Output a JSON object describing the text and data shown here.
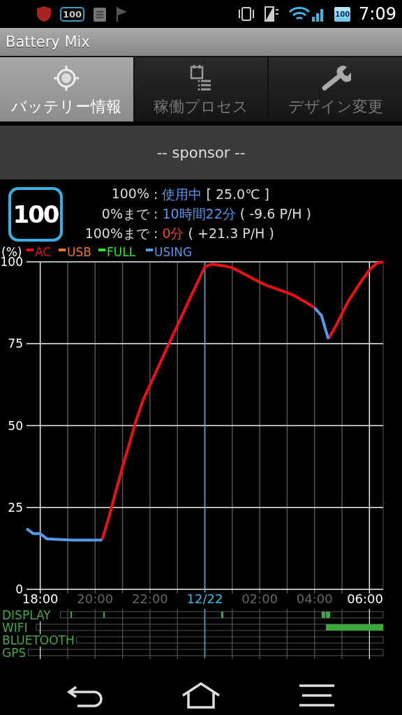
{
  "status_bar": {
    "notification_badge": "100",
    "battery": "100",
    "time": "7:09"
  },
  "title": "Battery Mix",
  "tabs": [
    {
      "label": "バッテリー情報",
      "selected": true
    },
    {
      "label": "稼働プロセス",
      "selected": false
    },
    {
      "label": "デザイン変更",
      "selected": false
    }
  ],
  "sponsor": "-- sponsor --",
  "battery_badge": "100",
  "info": [
    {
      "label": "100%",
      "separator": ":",
      "value": "使用中",
      "color": "#5599ee",
      "detail": "[ 25.0℃ ]"
    },
    {
      "label": "0%まで",
      "separator": ":",
      "value": "10時間22分",
      "color": "#5599ee",
      "detail": "( -9.6 P/H )"
    },
    {
      "label": "100%まで",
      "separator": ":",
      "value": "0分",
      "color": "#ee4422",
      "detail": "( +21.3 P/H )"
    }
  ],
  "chart_data": {
    "type": "line",
    "ylabel": "(%)",
    "ylim": [
      0,
      100
    ],
    "grid": true,
    "legend": true,
    "yticks": [
      0,
      25,
      50,
      75,
      100
    ],
    "categories": [
      null,
      null,
      "18:00",
      null,
      null,
      null,
      null,
      null,
      null,
      null,
      "20:00",
      null,
      null,
      null,
      null,
      null,
      null,
      null,
      "22:00",
      null,
      null,
      null,
      null,
      null,
      null,
      null,
      "12/22",
      null,
      null,
      null,
      null,
      null,
      null,
      null,
      "02:00",
      null,
      null,
      null,
      null,
      null,
      null,
      null,
      "04:00",
      null,
      null,
      null,
      null,
      null,
      null,
      null,
      "06:00",
      null,
      null
    ],
    "ref_lines": [
      {
        "axis": "x",
        "value": "12/22",
        "color": "#33bbee"
      }
    ],
    "series": [
      {
        "name": "AC",
        "color": "#ee1111",
        "values": [
          null,
          null,
          null,
          null,
          null,
          null,
          null,
          null,
          null,
          null,
          null,
          15,
          21.9,
          29.8,
          37.4,
          44.5,
          51.7,
          57.8,
          62.4,
          66.9,
          71.5,
          76.1,
          80.6,
          85.1,
          89.6,
          94.0,
          98.5,
          99.3,
          99.0,
          98.7,
          98.2,
          97.1,
          96.0,
          94.9,
          93.8,
          92.8,
          92.1,
          91.3,
          90.6,
          89.7,
          88.5,
          87.3,
          86.0,
          null,
          76.5,
          80.0,
          84.2,
          88.3,
          91.5,
          94.7,
          97.5,
          99.5,
          100
        ]
      },
      {
        "name": "USB",
        "color": "#ee7711",
        "values": [
          null,
          null,
          null,
          null,
          null,
          null,
          null,
          null,
          null,
          null,
          null,
          null,
          null,
          null,
          null,
          null,
          null,
          null,
          null,
          null,
          null,
          null,
          null,
          null,
          null,
          null,
          null,
          null,
          null,
          null,
          null,
          null,
          null,
          null,
          null,
          null,
          null,
          null,
          null,
          null,
          null,
          null,
          null,
          null,
          null,
          null,
          null,
          null,
          null,
          null,
          null,
          null,
          null
        ]
      },
      {
        "name": "FULL",
        "color": "#22ee22",
        "values": [
          null,
          null,
          null,
          null,
          null,
          null,
          null,
          null,
          null,
          null,
          null,
          null,
          null,
          null,
          null,
          null,
          null,
          null,
          null,
          null,
          null,
          null,
          null,
          null,
          null,
          null,
          null,
          null,
          null,
          null,
          null,
          null,
          null,
          null,
          null,
          null,
          null,
          null,
          null,
          null,
          null,
          null,
          null,
          null,
          null,
          null,
          null,
          null,
          null,
          null,
          null,
          null,
          null
        ]
      },
      {
        "name": "USING",
        "color": "#5599ee",
        "values": [
          18.5,
          17,
          17,
          15.4,
          15.3,
          15.2,
          15.1,
          15,
          15,
          15,
          15,
          15,
          null,
          null,
          null,
          null,
          null,
          null,
          null,
          null,
          null,
          null,
          null,
          null,
          null,
          null,
          null,
          null,
          null,
          null,
          null,
          null,
          null,
          null,
          null,
          null,
          null,
          null,
          null,
          null,
          null,
          null,
          86.0,
          83.6,
          76.5,
          null,
          null,
          null,
          null,
          null,
          null,
          null,
          null
        ]
      }
    ]
  },
  "lanes": [
    "DISPLAY",
    "WIFI",
    "BLUETOOTH",
    "GPS"
  ]
}
